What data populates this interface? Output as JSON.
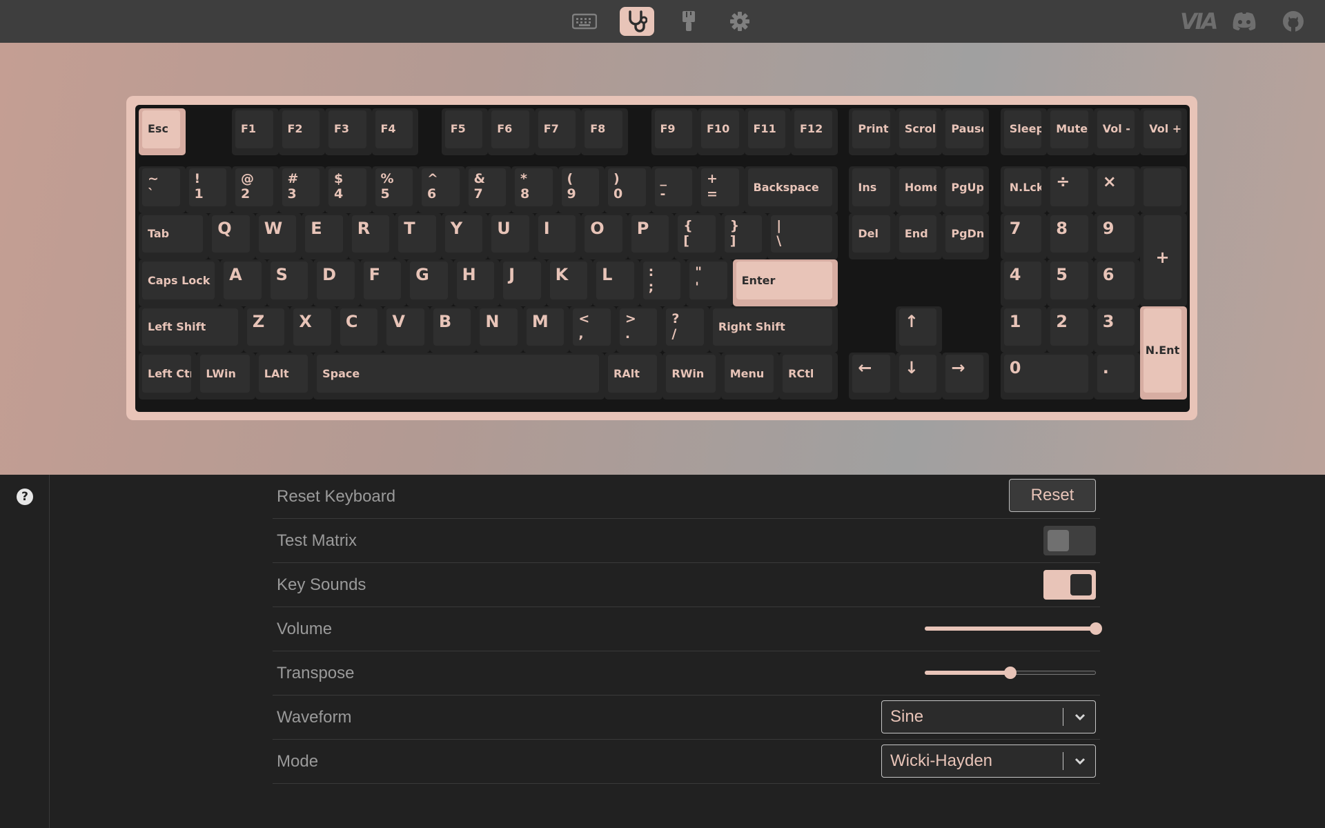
{
  "nav": {
    "tabs": [
      "keyboard-icon",
      "stethoscope-icon",
      "paintbrush-icon",
      "gear-icon"
    ],
    "active_tab": "stethoscope-icon",
    "brand": "VIA",
    "links": [
      "discord-icon",
      "github-icon"
    ]
  },
  "keyboard": {
    "keys": [
      {
        "id": "esc",
        "label": "Esc",
        "accent": true
      },
      {
        "id": "f1",
        "label": "F1"
      },
      {
        "id": "f2",
        "label": "F2"
      },
      {
        "id": "f3",
        "label": "F3"
      },
      {
        "id": "f4",
        "label": "F4"
      },
      {
        "id": "f5",
        "label": "F5"
      },
      {
        "id": "f6",
        "label": "F6"
      },
      {
        "id": "f7",
        "label": "F7"
      },
      {
        "id": "f8",
        "label": "F8"
      },
      {
        "id": "f9",
        "label": "F9"
      },
      {
        "id": "f10",
        "label": "F10"
      },
      {
        "id": "f11",
        "label": "F11"
      },
      {
        "id": "f12",
        "label": "F12"
      },
      {
        "id": "print",
        "label": "Print"
      },
      {
        "id": "scroll",
        "label": "Scroll"
      },
      {
        "id": "pause",
        "label": "Pause"
      },
      {
        "id": "sleep",
        "label": "Sleep"
      },
      {
        "id": "mute",
        "label": "Mute"
      },
      {
        "id": "vol-down",
        "label": "Vol -"
      },
      {
        "id": "vol-up",
        "label": "Vol +"
      },
      {
        "id": "grave",
        "label": "~\n`"
      },
      {
        "id": "1",
        "label": "!\n1"
      },
      {
        "id": "2",
        "label": "@\n2"
      },
      {
        "id": "3",
        "label": "#\n3"
      },
      {
        "id": "4",
        "label": "$\n4"
      },
      {
        "id": "5",
        "label": "%\n5"
      },
      {
        "id": "6",
        "label": "^\n6"
      },
      {
        "id": "7",
        "label": "&\n7"
      },
      {
        "id": "8",
        "label": "*\n8"
      },
      {
        "id": "9",
        "label": "(\n9"
      },
      {
        "id": "0",
        "label": ")\n0"
      },
      {
        "id": "minus",
        "label": "_\n-"
      },
      {
        "id": "equal",
        "label": "+\n="
      },
      {
        "id": "backspace",
        "label": "Backspace"
      },
      {
        "id": "ins",
        "label": "Ins"
      },
      {
        "id": "home",
        "label": "Home"
      },
      {
        "id": "pgup",
        "label": "PgUp"
      },
      {
        "id": "numlock",
        "label": "N.Lck"
      },
      {
        "id": "kp-div",
        "label": "÷"
      },
      {
        "id": "kp-mul",
        "label": "×"
      },
      {
        "id": "kp-blank",
        "label": ""
      },
      {
        "id": "tab",
        "label": "Tab"
      },
      {
        "id": "q",
        "label": "Q"
      },
      {
        "id": "w",
        "label": "W"
      },
      {
        "id": "e",
        "label": "E"
      },
      {
        "id": "r",
        "label": "R"
      },
      {
        "id": "t",
        "label": "T"
      },
      {
        "id": "y",
        "label": "Y"
      },
      {
        "id": "u",
        "label": "U"
      },
      {
        "id": "i",
        "label": "I"
      },
      {
        "id": "o",
        "label": "O"
      },
      {
        "id": "p",
        "label": "P"
      },
      {
        "id": "lbracket",
        "label": "{\n["
      },
      {
        "id": "rbracket",
        "label": "}\n]"
      },
      {
        "id": "backslash",
        "label": "|\n\\"
      },
      {
        "id": "del",
        "label": "Del"
      },
      {
        "id": "end",
        "label": "End"
      },
      {
        "id": "pgdn",
        "label": "PgDn"
      },
      {
        "id": "kp7",
        "label": "7"
      },
      {
        "id": "kp8",
        "label": "8"
      },
      {
        "id": "kp9",
        "label": "9"
      },
      {
        "id": "kp-plus",
        "label": "+"
      },
      {
        "id": "caps",
        "label": "Caps Lock"
      },
      {
        "id": "a",
        "label": "A"
      },
      {
        "id": "s",
        "label": "S"
      },
      {
        "id": "d",
        "label": "D"
      },
      {
        "id": "f",
        "label": "F"
      },
      {
        "id": "g",
        "label": "G"
      },
      {
        "id": "h",
        "label": "H"
      },
      {
        "id": "j",
        "label": "J"
      },
      {
        "id": "k",
        "label": "K"
      },
      {
        "id": "l",
        "label": "L"
      },
      {
        "id": "semicolon",
        "label": ":\n;"
      },
      {
        "id": "quote",
        "label": "\"\n'"
      },
      {
        "id": "enter",
        "label": "Enter",
        "accent": true
      },
      {
        "id": "kp4",
        "label": "4"
      },
      {
        "id": "kp5",
        "label": "5"
      },
      {
        "id": "kp6",
        "label": "6"
      },
      {
        "id": "lshift",
        "label": "Left Shift"
      },
      {
        "id": "z",
        "label": "Z"
      },
      {
        "id": "x",
        "label": "X"
      },
      {
        "id": "c",
        "label": "C"
      },
      {
        "id": "v",
        "label": "V"
      },
      {
        "id": "b",
        "label": "B"
      },
      {
        "id": "n",
        "label": "N"
      },
      {
        "id": "m",
        "label": "M"
      },
      {
        "id": "comma",
        "label": "<\n,"
      },
      {
        "id": "period",
        "label": ">\n."
      },
      {
        "id": "slash",
        "label": "?\n/"
      },
      {
        "id": "rshift",
        "label": "Right Shift"
      },
      {
        "id": "up",
        "label": "↑"
      },
      {
        "id": "kp1",
        "label": "1"
      },
      {
        "id": "kp2",
        "label": "2"
      },
      {
        "id": "kp3",
        "label": "3"
      },
      {
        "id": "kp-enter",
        "label": "N.Ent",
        "accent": true
      },
      {
        "id": "lctrl",
        "label": "Left Ctrl"
      },
      {
        "id": "lwin",
        "label": "LWin"
      },
      {
        "id": "lalt",
        "label": "LAlt"
      },
      {
        "id": "space",
        "label": "Space"
      },
      {
        "id": "ralt",
        "label": "RAlt"
      },
      {
        "id": "rwin",
        "label": "RWin"
      },
      {
        "id": "menu",
        "label": "Menu"
      },
      {
        "id": "rctrl",
        "label": "RCtl"
      },
      {
        "id": "left",
        "label": "←"
      },
      {
        "id": "down",
        "label": "↓"
      },
      {
        "id": "right",
        "label": "→"
      },
      {
        "id": "kp0",
        "label": "0"
      },
      {
        "id": "kp-dot",
        "label": "."
      }
    ]
  },
  "settings": {
    "reset_label": "Reset Keyboard",
    "reset_button": "Reset",
    "test_matrix_label": "Test Matrix",
    "test_matrix_on": false,
    "key_sounds_label": "Key Sounds",
    "key_sounds_on": true,
    "volume_label": "Volume",
    "volume_value": 1.0,
    "transpose_label": "Transpose",
    "transpose_value": 0.5,
    "waveform_label": "Waveform",
    "waveform_value": "Sine",
    "mode_label": "Mode",
    "mode_value": "Wicki-Hayden"
  },
  "help_icon": "question-circle-icon",
  "colors": {
    "accent": "#e8c4b8",
    "bg": "#212121",
    "topbar": "#3e3e3e",
    "key": "#2f2f2f"
  }
}
